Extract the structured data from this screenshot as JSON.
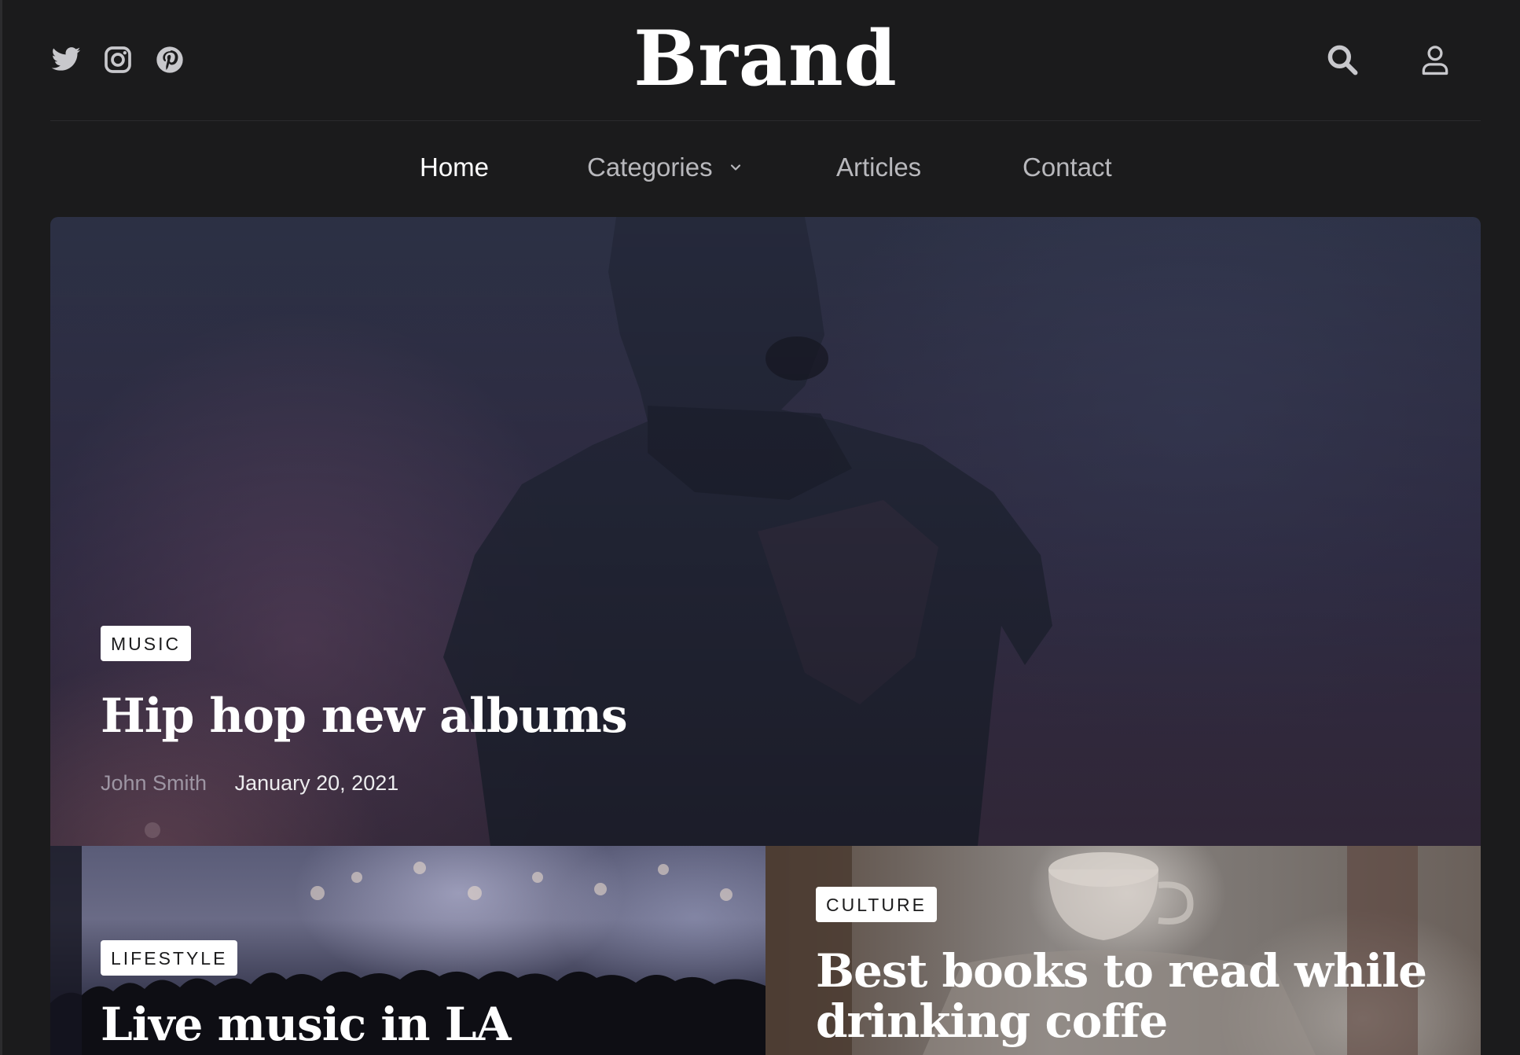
{
  "header": {
    "brand": "Brand",
    "social_icons": [
      "twitter-icon",
      "instagram-icon",
      "pinterest-icon"
    ],
    "actions": [
      "search-icon",
      "user-icon"
    ]
  },
  "nav": {
    "items": [
      {
        "label": "Home",
        "active": true
      },
      {
        "label": "Categories",
        "has_dropdown": true
      },
      {
        "label": "Articles"
      },
      {
        "label": "Contact"
      }
    ]
  },
  "hero": {
    "tag": "MUSIC",
    "title": "Hip hop new albums",
    "author": "John Smith",
    "date": "January 20, 2021"
  },
  "cards": [
    {
      "tag": "LIFESTYLE",
      "title": "Live music in LA"
    },
    {
      "tag": "CULTURE",
      "title": "Best books to read while drinking coffe"
    }
  ],
  "colors": {
    "background": "#1b1b1c",
    "text": "#ffffff",
    "nav_inactive": "#b8b8bc",
    "author": "#9d95a3",
    "tag_bg": "#ffffff",
    "tag_text": "#1b1b1c"
  }
}
